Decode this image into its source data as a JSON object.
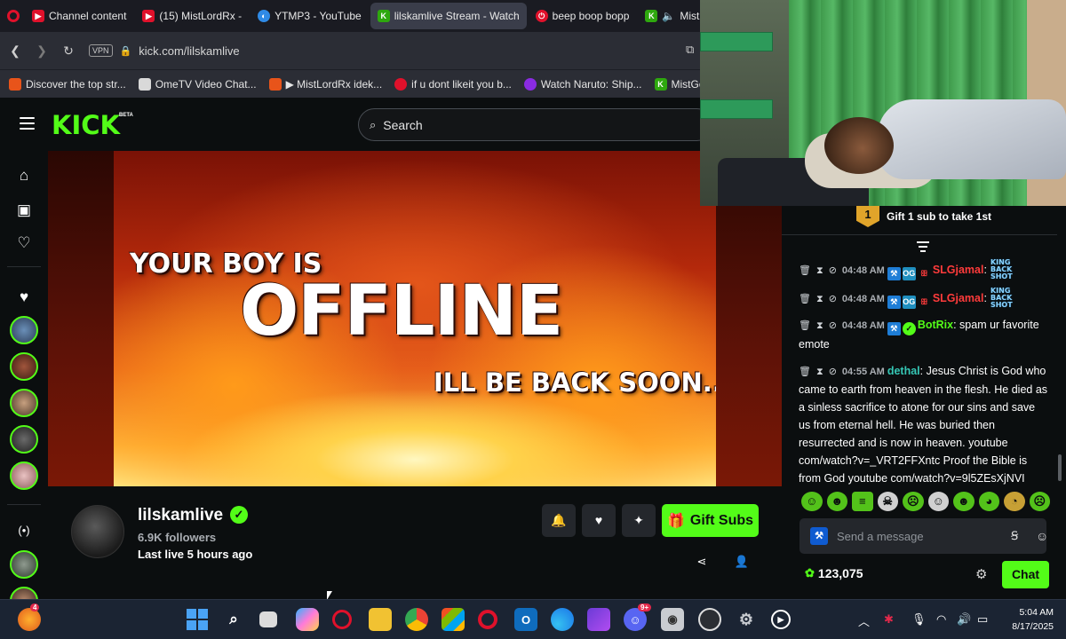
{
  "browser": {
    "tabs": [
      {
        "label": "Channel content",
        "fav_color": "#e0112b",
        "fav": "▶",
        "active": false
      },
      {
        "label": "(15) MistLordRx -",
        "fav_color": "#e0112b",
        "fav": "▶",
        "active": false
      },
      {
        "label": "YTMP3 - YouTube",
        "fav_color": "#2f8ae6",
        "fav": "◐",
        "active": false
      },
      {
        "label": "lilskamlive Stream - Watch",
        "fav_color": "#2ea80e",
        "fav": "K",
        "active": true
      },
      {
        "label": "beep boop bopp",
        "fav_color": "#e0112b",
        "fav": "⏻",
        "active": false
      },
      {
        "label": "MistGodRx St",
        "fav_color": "#2ea80e",
        "fav": "K",
        "active": false
      }
    ],
    "url": "kick.com/lilskamlive",
    "vpn_label": "VPN",
    "bookmarks": [
      {
        "label": "Discover the top str...",
        "fav_color": "#e8541a"
      },
      {
        "label": "OmeTV Video Chat...",
        "fav_color": "#d9d9d9"
      },
      {
        "label": "▶ MistLordRx idek...",
        "fav_color": "#e8541a"
      },
      {
        "label": "if u dont likeit you b...",
        "fav_color": "#e0112b"
      },
      {
        "label": "Watch Naruto: Ship...",
        "fav_color": "#8a2be2"
      },
      {
        "label": "MistGodR",
        "fav_color": "#2ea80e"
      }
    ]
  },
  "kick": {
    "logo": "KICK",
    "beta": "BETA",
    "search_placeholder": "Search"
  },
  "player": {
    "line1": "YOUR BOY IS",
    "line2": "OFFLINE",
    "line3": "ILL BE BACK SOON...."
  },
  "channel": {
    "name": "lilskamlive",
    "followers": "6.9K followers",
    "last_live": "Last live 5 hours ago",
    "gift_label": "Gift Subs"
  },
  "chat": {
    "pinned_rank": "1",
    "pinned_text": "Gift 1 sub to take 1st",
    "messages": [
      {
        "time": "04:48 AM",
        "user": "SLGjamal",
        "user_color": "#ff3b3b",
        "text": "",
        "emote": "KING BACK SHOT"
      },
      {
        "time": "04:48 AM",
        "user": "SLGjamal",
        "user_color": "#ff3b3b",
        "text": "",
        "emote": "KING BACK SHOT"
      },
      {
        "time": "04:48 AM",
        "user": "BotRix",
        "user_color": "#53fc18",
        "text": "spam ur favorite emote",
        "emote": ""
      },
      {
        "time": "04:55 AM",
        "user": "dethal",
        "user_color": "#35c7b5",
        "text": "Jesus Christ is God who came to earth from heaven in the flesh. He died as a sinless sacrifice to atone for our sins and save us from eternal hell. He was buried then resurrected and is now in heaven. youtube com/watch?v=_VRT2FFXntc Proof the Bible is from God youtube com/watch?v=9l5ZEsXjNVI",
        "emote": ""
      }
    ],
    "input_placeholder": "Send a message",
    "points": "123,075",
    "chat_button": "Chat"
  },
  "taskbar": {
    "time": "5:04 AM",
    "date": "8/17/2025",
    "discord_badge": "9+",
    "firefox_badge": "4"
  }
}
